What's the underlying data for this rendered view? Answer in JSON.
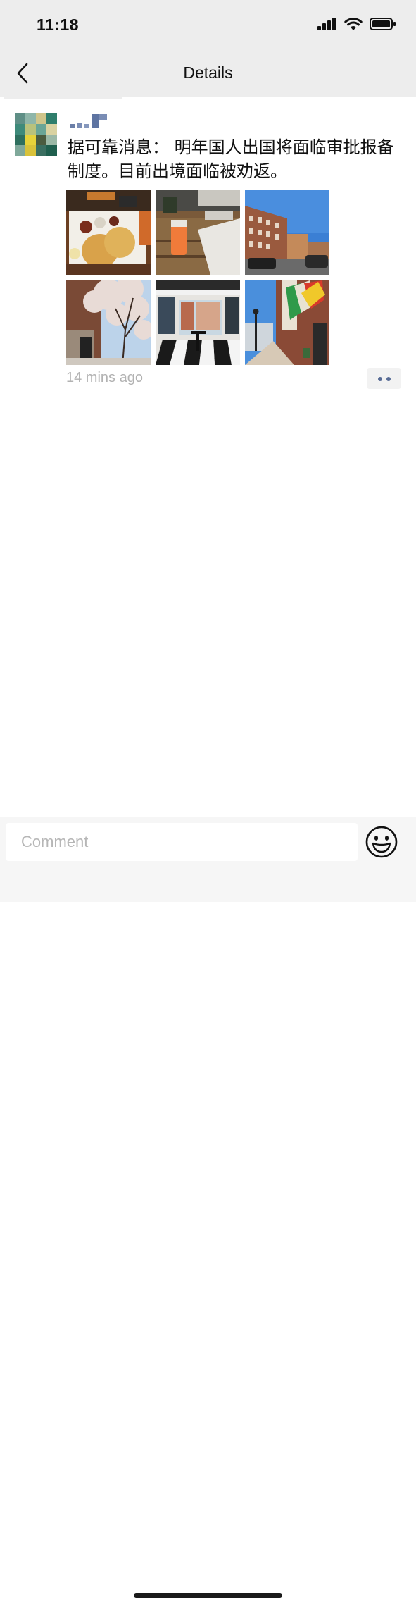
{
  "status_bar": {
    "time": "11:18",
    "icons": [
      "cellular-signal-icon",
      "wifi-icon",
      "battery-icon"
    ]
  },
  "nav": {
    "title": "Details",
    "back_icon": "chevron-left-icon"
  },
  "post": {
    "text": "据可靠消息： 明年国人出国将面临审批报备制度。目前出境面临被劝返。",
    "timestamp": "14 mins ago",
    "photos": [
      {
        "subject": "pancakes breakfast"
      },
      {
        "subject": "drink on cafe table"
      },
      {
        "subject": "brick buildings street"
      },
      {
        "subject": "blossoming tree street"
      },
      {
        "subject": "cafe interior checkered floor"
      },
      {
        "subject": "sidewalk with flags"
      }
    ],
    "more_icon": "ellipsis-icon"
  },
  "comment_bar": {
    "placeholder": "Comment",
    "emoji_icon": "smiley-face-icon"
  },
  "colors": {
    "header_bg": "#ededed",
    "link_blue": "#576b95",
    "timestamp_gray": "#b2b2b2"
  }
}
